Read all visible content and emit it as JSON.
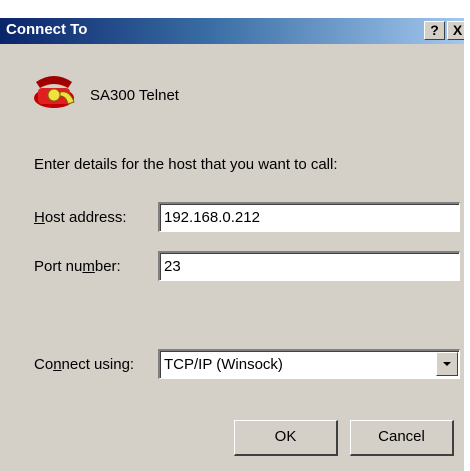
{
  "window": {
    "title": "Connect To",
    "help_label": "?",
    "close_label": "X"
  },
  "connection": {
    "name": "SA300 Telnet",
    "icon": "phone-icon"
  },
  "prompt": "Enter details for the host that you want to call:",
  "fields": {
    "host_label_accel": "H",
    "host_label_rest": "ost address:",
    "host_value": "192.168.0.212",
    "port_label_pre": "Port nu",
    "port_label_accel": "m",
    "port_label_post": "ber:",
    "port_value": "23",
    "connect_label_pre": "Co",
    "connect_label_accel": "n",
    "connect_label_post": "nect using:",
    "connect_value": "TCP/IP (Winsock)"
  },
  "buttons": {
    "ok": "OK",
    "cancel": "Cancel"
  }
}
